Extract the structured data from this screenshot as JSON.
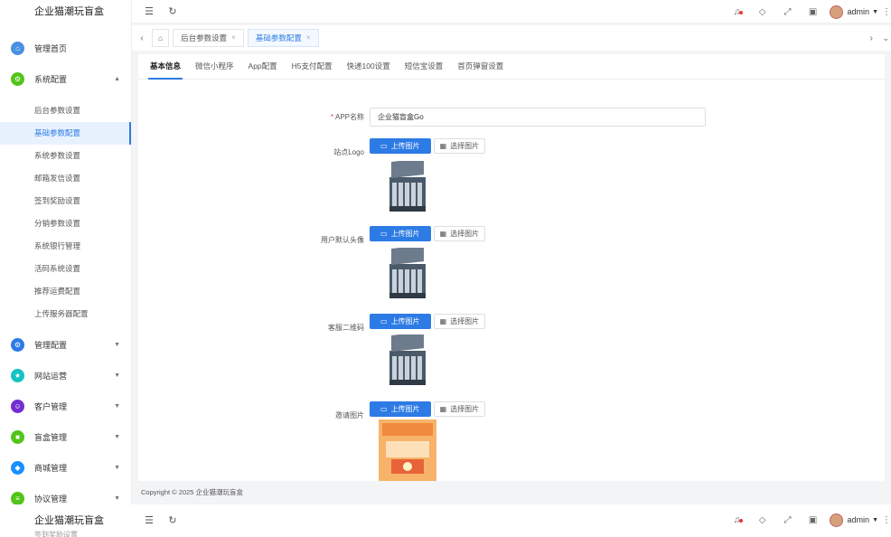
{
  "app": {
    "name": "企业猫潮玩盲盒"
  },
  "sidebar": {
    "groups": [
      {
        "label": "管理首页",
        "color": "#4a90e2",
        "icon": "home-icon"
      },
      {
        "label": "系统配置",
        "color": "#52c41a",
        "icon": "gear-icon"
      }
    ],
    "sub_items": [
      "后台参数设置",
      "基础参数配置",
      "系统参数设置",
      "邮箱发信设置",
      "签到奖励设置",
      "分销参数设置",
      "系统银行管理",
      "活码系统设置",
      "推荐运费配置",
      "上传服务器配置"
    ],
    "lower_groups": [
      {
        "label": "管理配置",
        "color": "#2d7be5",
        "icon": "settings-icon"
      },
      {
        "label": "网站运营",
        "color": "#13c2c2",
        "icon": "star-icon"
      },
      {
        "label": "客户管理",
        "color": "#722ed1",
        "icon": "user-icon"
      },
      {
        "label": "盲盒管理",
        "color": "#52c41a",
        "icon": "box-icon"
      },
      {
        "label": "商城管理",
        "color": "#1890ff",
        "icon": "shop-icon"
      },
      {
        "label": "协议管理",
        "color": "#52c41a",
        "icon": "doc-icon"
      }
    ]
  },
  "header": {
    "user": "admin"
  },
  "tags": {
    "tab1": "后台参数设置",
    "tab2": "基础参数配置"
  },
  "subtabs": [
    "基本信息",
    "微信小程序",
    "App配置",
    "H5支付配置",
    "快递100设置",
    "短信宝设置",
    "首页弹窗设置"
  ],
  "form": {
    "app_name_label": "APP名称",
    "app_name_value": "企业猫盲盒Go",
    "logo_label": "站点Logo",
    "avatar_label": "用户默认头像",
    "qrcode_label": "客服二维码",
    "invite_label": "邀请图片",
    "upload_label": "上传图片",
    "pick_label": "选择图片"
  },
  "footer": {
    "copyright": "Copyright © 2025 企业猫潮玩盲盒"
  },
  "bottom": {
    "cut_label": "签到奖励设置"
  }
}
